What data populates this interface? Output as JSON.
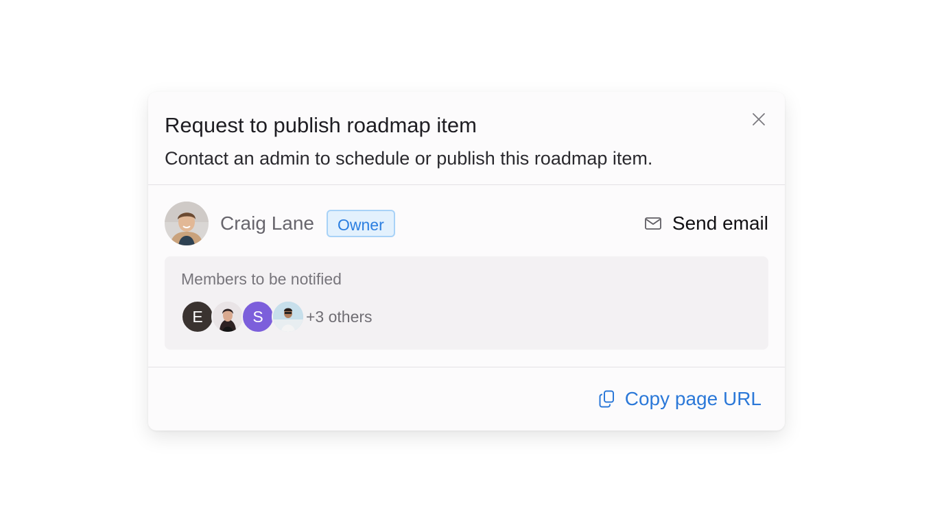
{
  "dialog": {
    "title": "Request to publish roadmap item",
    "subtitle": "Contact an admin to schedule or publish this roadmap item.",
    "close_icon": "close-icon"
  },
  "owner": {
    "name": "Craig Lane",
    "badge": "Owner",
    "avatar": "avatar-photo",
    "send_email_label": "Send email",
    "send_email_icon": "mail-icon"
  },
  "members": {
    "label": "Members to be notified",
    "avatars": [
      {
        "initial": "E",
        "color": "#3a3330"
      },
      {
        "initial": "",
        "color": "#e7e2e4"
      },
      {
        "initial": "S",
        "color": "#7c5fdb"
      },
      {
        "initial": "",
        "color": "#b9d4e4"
      }
    ],
    "others": "+3 others"
  },
  "footer": {
    "copy_url_label": "Copy page URL",
    "copy_url_icon": "copy-icon"
  },
  "colors": {
    "accent": "#2b78d8",
    "badge_border": "#a8d2f7",
    "badge_bg": "#e3f1fd"
  }
}
